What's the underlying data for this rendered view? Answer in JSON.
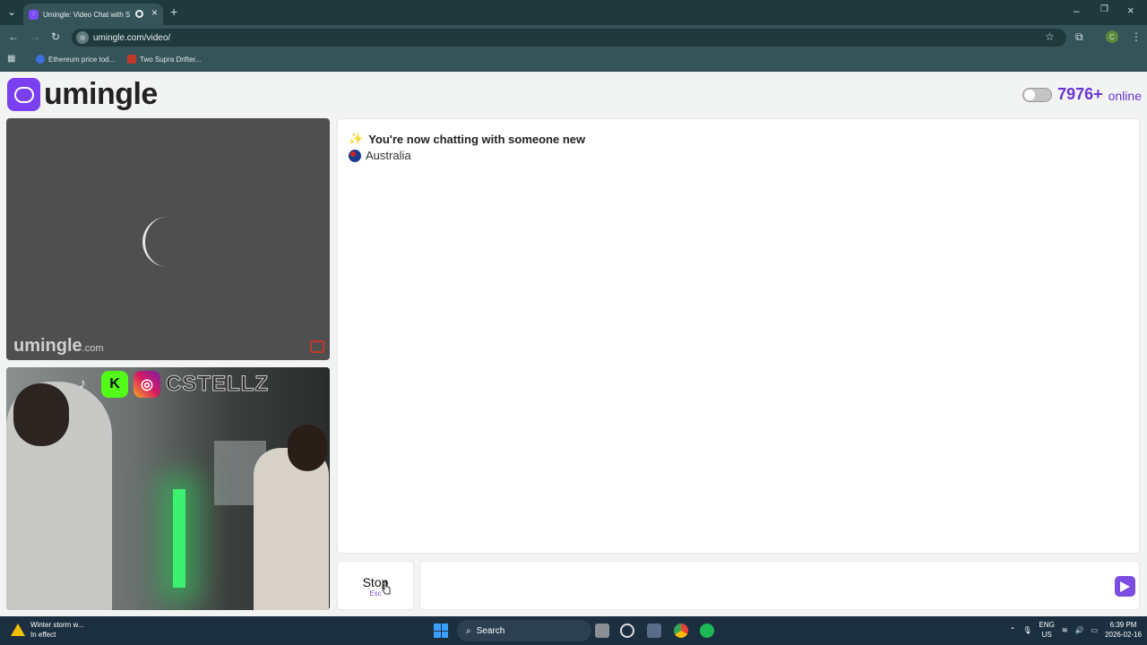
{
  "browser": {
    "tab_title": "Umingle: Video Chat with S",
    "url": "umingle.com/video/",
    "profile_initial": "C",
    "bookmarks": [
      {
        "label": "Ethereum price tod..."
      },
      {
        "label": "Two Supra Drifter..."
      }
    ]
  },
  "header": {
    "logo_text": "umingle",
    "online_count": "7976+",
    "online_label": "online",
    "toggle_on": false
  },
  "video": {
    "watermark": "umingle",
    "watermark_suffix": ".com",
    "social_handle": "CSTELLZ"
  },
  "chat": {
    "system_message": "You're now chatting with someone new",
    "country": "Australia",
    "input_value": "",
    "input_placeholder": ""
  },
  "controls": {
    "stop_label": "Stop",
    "stop_hint": "Esc"
  },
  "taskbar": {
    "weather_title": "Winter storm w...",
    "weather_sub": "In effect",
    "search_label": "Search",
    "lang_top": "ENG",
    "lang_bottom": "US",
    "time": "6:39 PM",
    "date": "2026-02-16"
  },
  "colors": {
    "brand": "#7b3ff2",
    "online": "#6a34d6",
    "chrome": "#35545a"
  }
}
